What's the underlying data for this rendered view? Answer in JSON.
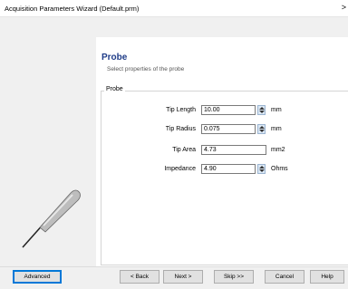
{
  "window": {
    "title": "Acquisition Parameters Wizard (Default.prm)",
    "close_glyph": ">"
  },
  "page": {
    "title": "Probe",
    "subtitle": "Select properties of the probe"
  },
  "group": {
    "label": "Probe"
  },
  "fields": [
    {
      "label": "Tip Length",
      "value": "10.00",
      "unit": "mm",
      "spinner": true
    },
    {
      "label": "Tip Radius",
      "value": "0.075",
      "unit": "mm",
      "spinner": true
    },
    {
      "label": "Tip Area",
      "value": "4.73",
      "unit": "mm2",
      "spinner": false
    },
    {
      "label": "Impedance",
      "value": "4.90",
      "unit": "Ohms",
      "spinner": true
    }
  ],
  "buttons": {
    "advanced": "Advanced",
    "back": "< Back",
    "next": "Next >",
    "skip": "Skip >>",
    "cancel": "Cancel",
    "help": "Help"
  },
  "icons": {
    "probe": "probe-icon",
    "spin": "spinner-arrows-icon"
  },
  "colors": {
    "title_blue": "#1f3c88",
    "accent": "#0078d7"
  }
}
